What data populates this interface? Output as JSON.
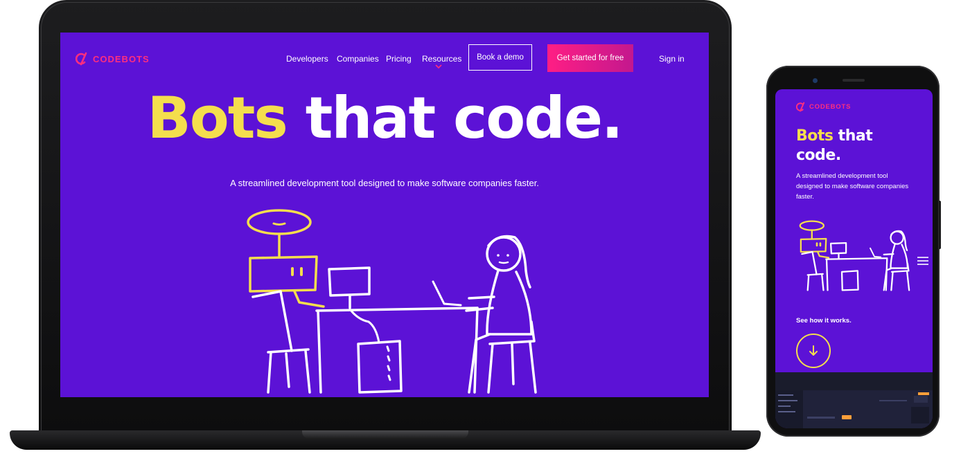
{
  "brand": {
    "name": "CODEBOTS",
    "logo_color": "#ff2e7e",
    "background": "#5c12d6",
    "accent_yellow": "#f4de4d",
    "cta_gradient": [
      "#ff1e84",
      "#c3188e"
    ]
  },
  "laptop": {
    "nav": {
      "developers": "Developers",
      "companies": "Companies",
      "pricing": "Pricing",
      "resources": "Resources",
      "book_demo": "Book a demo",
      "get_started": "Get started for free",
      "sign_in": "Sign in"
    },
    "hero": {
      "headline_highlight": "Bots",
      "headline_rest": "that code.",
      "subtitle": "A streamlined development tool designed to make software companies faster."
    }
  },
  "phone": {
    "hero": {
      "headline_highlight": "Bots",
      "headline_line1_rest": "that",
      "headline_line2": "code.",
      "subtitle": "A streamlined development tool designed to make software companies faster."
    },
    "see_how": "See how it works.",
    "icons": {
      "menu": "hamburger-menu-icon",
      "scroll": "arrow-down-icon"
    }
  }
}
